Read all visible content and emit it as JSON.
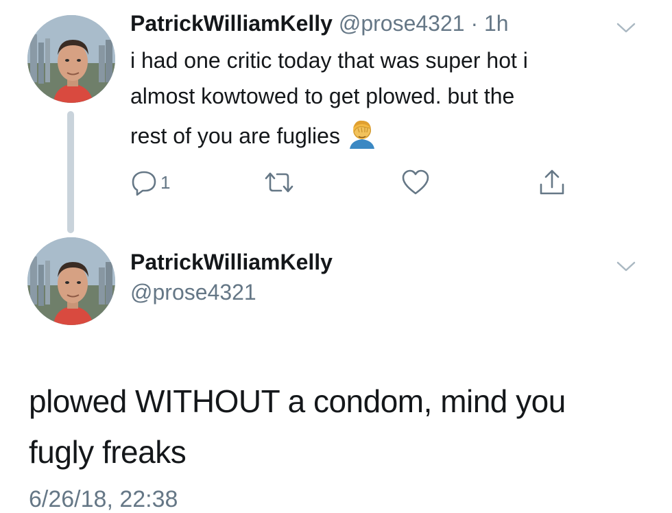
{
  "tweet1": {
    "display_name": "PatrickWilliamKelly",
    "handle": "@prose4321",
    "time": "· 1h",
    "line1": "i had one critic today that was super hot i",
    "line2": "almost kowtowed to get plowed. but the",
    "line3": "rest of you are fuglies",
    "emoji_icon": "face-palm-icon",
    "actions": {
      "reply_icon": "reply-icon",
      "reply_count": "1",
      "retweet_icon": "retweet-icon",
      "like_icon": "heart-icon",
      "share_icon": "share-icon"
    }
  },
  "tweet2": {
    "display_name": "PatrickWilliamKelly",
    "handle": "@prose4321",
    "line1": "plowed WITHOUT a condom, mind you",
    "line2": "fugly freaks",
    "timestamp": "6/26/18, 22:38"
  },
  "colors": {
    "text": "#14171a",
    "secondary": "#657786",
    "thread_line": "#c9d3db",
    "chevron": "#aab8c2"
  }
}
